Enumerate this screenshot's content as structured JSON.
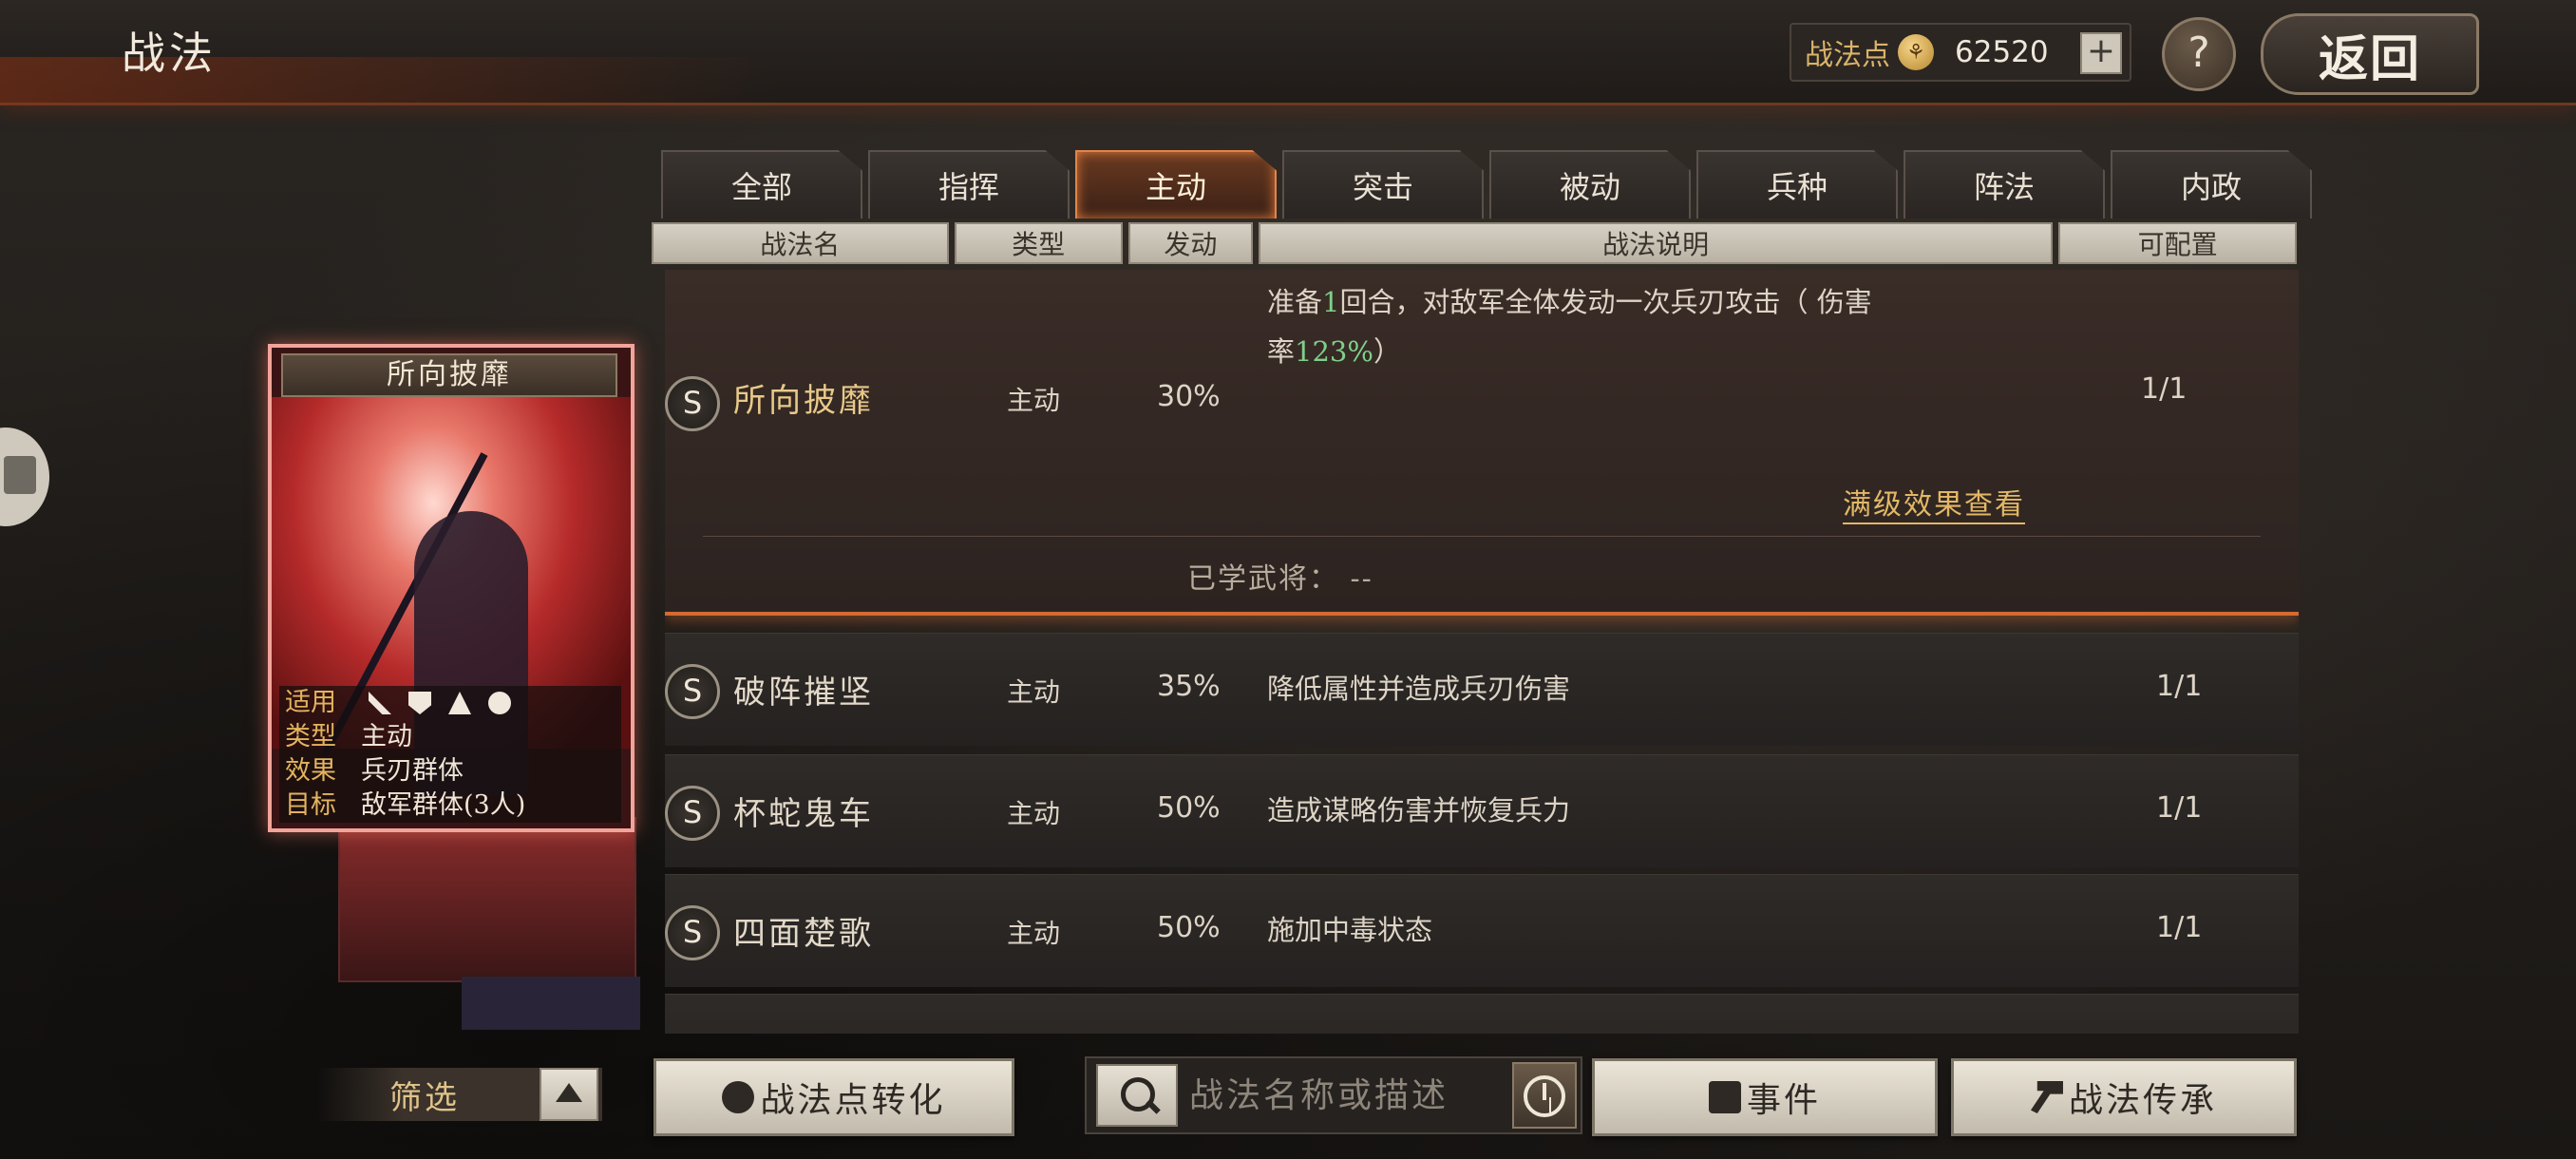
{
  "header": {
    "title": "战法",
    "points_label": "战法点",
    "points_value": "62520",
    "plus_label": "+",
    "help_label": "?",
    "back_label": "返回"
  },
  "tabs": [
    {
      "label": "全部",
      "active": false
    },
    {
      "label": "指挥",
      "active": false
    },
    {
      "label": "主动",
      "active": true
    },
    {
      "label": "突击",
      "active": false
    },
    {
      "label": "被动",
      "active": false
    },
    {
      "label": "兵种",
      "active": false
    },
    {
      "label": "阵法",
      "active": false
    },
    {
      "label": "内政",
      "active": false
    }
  ],
  "columns": [
    "战法名",
    "类型",
    "发动",
    "战法说明",
    "可配置"
  ],
  "skills": [
    {
      "badge": "S",
      "name": "所向披靡",
      "type": "主动",
      "rate": "30%",
      "desc_a": "准备",
      "desc_num1": "1",
      "desc_b": "回合，对敌军全体发动一次兵刃攻击（ 伤害",
      "desc_c": "率",
      "desc_num2": "123%",
      "desc_d": "）",
      "config": "1/1",
      "full_link": "满级效果查看",
      "learned": "已学武将：  --"
    },
    {
      "badge": "S",
      "name": "破阵摧坚",
      "type": "主动",
      "rate": "35%",
      "desc": "降低属性并造成兵刃伤害",
      "config": "1/1"
    },
    {
      "badge": "S",
      "name": "杯蛇鬼车",
      "type": "主动",
      "rate": "50%",
      "desc": "造成谋略伤害并恢复兵力",
      "config": "1/1"
    },
    {
      "badge": "S",
      "name": "四面楚歌",
      "type": "主动",
      "rate": "50%",
      "desc": "施加中毒状态",
      "config": "1/1"
    }
  ],
  "card": {
    "title": "所向披靡",
    "apply_label": "适用",
    "apply_icons": [
      "cavalry-icon",
      "shield-icon",
      "archer-icon",
      "wheel-icon"
    ],
    "type_label": "类型",
    "type_value": "主动",
    "effect_label": "效果",
    "effect_value": "兵刃群体",
    "target_label": "目标",
    "target_value": "敌军群体(3人)"
  },
  "bottom": {
    "filter_label": "筛选",
    "convert_label": "战法点转化",
    "search_placeholder": "战法名称或描述",
    "event_label": "事件",
    "inherit_label": "战法传承"
  },
  "colors": {
    "accent_orange": "#e0854a",
    "gold_text": "#e2b866",
    "highlight_green": "#7fcf8a"
  }
}
